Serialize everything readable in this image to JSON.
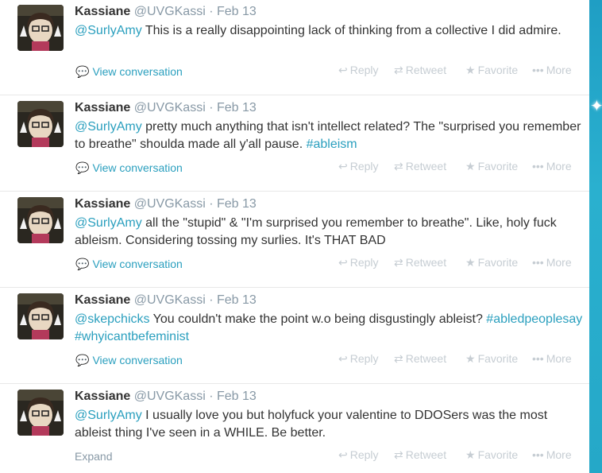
{
  "tweets": [
    {
      "name": "Kassiane",
      "handle": "@UVGKassi",
      "time": "Feb 13",
      "segments": [
        {
          "type": "mention",
          "text": "@SurlyAmy"
        },
        {
          "type": "text",
          "text": " This is a really disappointing lack of thinking from a collective I did admire."
        }
      ],
      "footer": "View conversation",
      "footer_type": "conversation"
    },
    {
      "name": "Kassiane",
      "handle": "@UVGKassi",
      "time": "Feb 13",
      "segments": [
        {
          "type": "mention",
          "text": "@SurlyAmy"
        },
        {
          "type": "text",
          "text": " pretty much anything that isn't intellect related? The \"surprised you remember to breathe\" shoulda made all y'all pause. "
        },
        {
          "type": "tag",
          "text": "#ableism"
        }
      ],
      "footer": "View conversation",
      "footer_type": "conversation"
    },
    {
      "name": "Kassiane",
      "handle": "@UVGKassi",
      "time": "Feb 13",
      "segments": [
        {
          "type": "mention",
          "text": "@SurlyAmy"
        },
        {
          "type": "text",
          "text": " all the \"stupid\" & \"I'm surprised you remember to breathe\". Like, holy fuck ableism. Considering tossing my surlies. It's THAT BAD"
        }
      ],
      "footer": "View conversation",
      "footer_type": "conversation"
    },
    {
      "name": "Kassiane",
      "handle": "@UVGKassi",
      "time": "Feb 13",
      "segments": [
        {
          "type": "mention",
          "text": "@skepchicks"
        },
        {
          "type": "text",
          "text": " You couldn't make the point w.o being disgustingly ableist? "
        },
        {
          "type": "tag",
          "text": "#abledpeoplesay"
        },
        {
          "type": "text",
          "text": " "
        },
        {
          "type": "tag",
          "text": "#whyicantbefeminist"
        }
      ],
      "footer": "View conversation",
      "footer_type": "conversation"
    },
    {
      "name": "Kassiane",
      "handle": "@UVGKassi",
      "time": "Feb 13",
      "segments": [
        {
          "type": "mention",
          "text": "@SurlyAmy"
        },
        {
          "type": "text",
          "text": " I usually love you but holyfuck your valentine to DDOSers was the most ableist thing I've seen in a WHILE. Be better."
        }
      ],
      "footer": "Expand",
      "footer_type": "expand"
    }
  ],
  "actions": {
    "reply": "Reply",
    "retweet": "Retweet",
    "favorite": "Favorite",
    "more": "More"
  },
  "icons": {
    "conversation": "speech-bubble-icon",
    "reply": "reply-arrow-icon",
    "retweet": "retweet-icon",
    "favorite": "star-icon",
    "more": "ellipsis-icon"
  },
  "colors": {
    "link": "#2a9fbe",
    "name": "#333333",
    "meta": "#8899a6",
    "action": "#c6cdd3",
    "background_accent": "#25a8c8"
  }
}
